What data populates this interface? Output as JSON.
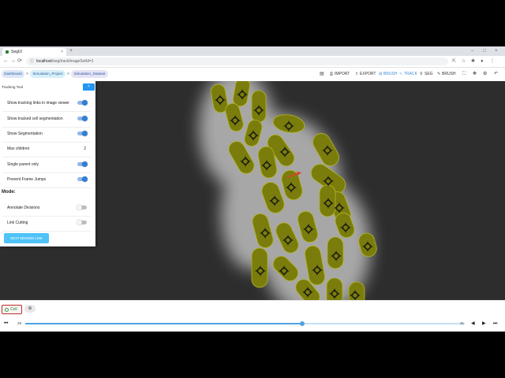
{
  "browser": {
    "tab_title": "SegUI",
    "tab_close": "×",
    "new_tab": "+",
    "window_controls": [
      "–",
      "□",
      "×"
    ],
    "nav": [
      "←",
      "→",
      "⟳"
    ],
    "url_host": "localhost",
    "url_rest": "/seg/trackImageSetId=1",
    "toolbar_icons": [
      "share-icon",
      "star-icon",
      "extensions-icon",
      "profile-icon",
      "menu-icon"
    ]
  },
  "breadcrumbs": [
    {
      "label": "Dashboard",
      "color": "#dce7f7"
    },
    {
      "label": "Simulation_Project",
      "color": "#d7f0f9"
    },
    {
      "label": "Simulation_Dataset",
      "color": "#e6e3f5"
    }
  ],
  "breadcrumb_separator": ">",
  "header_actions": [
    {
      "label": "IMPORT",
      "icon": "⎙",
      "active": false
    },
    {
      "label": "EXPORT",
      "icon": "⇪",
      "active": false
    },
    {
      "label": "BRUSH",
      "icon": "⊞",
      "active": true
    },
    {
      "label": "TRACK",
      "icon": "∿",
      "active": true
    },
    {
      "label": "SEG",
      "icon": "⚲",
      "active": false
    },
    {
      "label": "BRUSH",
      "icon": "✎",
      "active": false
    }
  ],
  "header_icons": [
    "⛶",
    "✥",
    "⚙",
    "↶"
  ],
  "tracking_panel": {
    "title": "Tracking Tool",
    "close_label": "×",
    "settings": [
      {
        "label": "Show tracking links in image viewer",
        "kind": "toggle",
        "on": true
      },
      {
        "label": "Show tracked cell segmentation",
        "kind": "toggle",
        "on": true
      },
      {
        "label": "Show Segmentation",
        "kind": "toggle",
        "on": true
      },
      {
        "label": "Max children",
        "kind": "number",
        "value": "2"
      },
      {
        "label": "Single parent only",
        "kind": "toggle",
        "on": true
      },
      {
        "label": "Prevent Frame Jumps",
        "kind": "toggle",
        "on": true
      }
    ],
    "mode_title": "Mode:",
    "modes": [
      {
        "label": "Annotate Divisions",
        "on": false
      },
      {
        "label": "Link Cutting",
        "on": false
      }
    ],
    "next_missing_label": "NEXT MISSING LINK"
  },
  "labels": {
    "active_label": "Cell",
    "active_label_color": "#43a047",
    "add_label_icon": "⊕"
  },
  "timeline": {
    "first_icon": "⏮",
    "prev_icon": "◀",
    "next_icon": "▶",
    "last_icon": "⏭",
    "start_frame": "29",
    "end_frame": "31",
    "position_fraction": 0.63
  },
  "colors": {
    "cell_fill": "#7a7d0c",
    "cell_stroke": "#b2b521",
    "link_color": "#e53935",
    "accent": "#2196f3"
  }
}
